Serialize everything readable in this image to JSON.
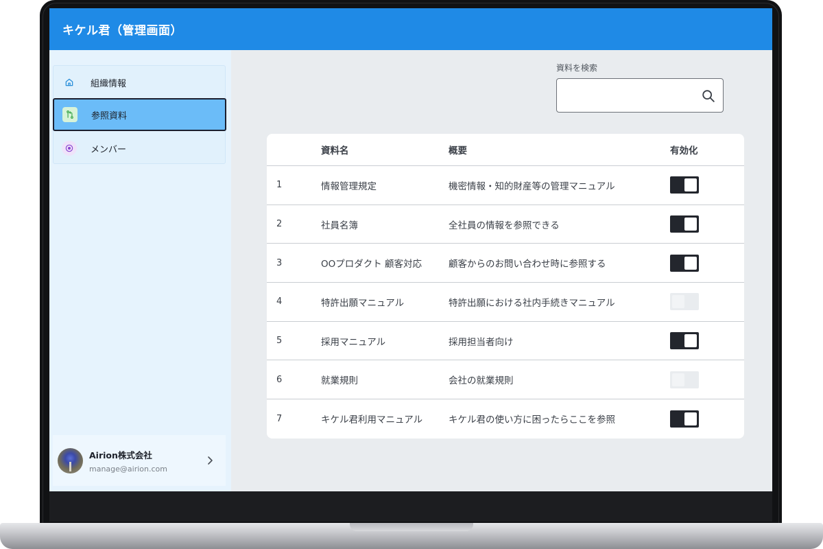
{
  "app": {
    "title": "キケル君（管理画面）"
  },
  "sidebar": {
    "items": [
      {
        "label": "組織情報",
        "icon": "home-icon",
        "active": false
      },
      {
        "label": "参照資料",
        "icon": "git-branch-icon",
        "active": true
      },
      {
        "label": "メンバー",
        "icon": "member-icon",
        "active": false
      }
    ],
    "user": {
      "name": "Airion株式会社",
      "email": "manage@airion.com"
    }
  },
  "search": {
    "label": "資料を検索",
    "value": "",
    "placeholder": ""
  },
  "table": {
    "headers": {
      "no": "",
      "name": "資料名",
      "description": "概要",
      "enabled": "有効化"
    },
    "rows": [
      {
        "no": "1",
        "name": "情報管理規定",
        "description": "機密情報・知的財産等の管理マニュアル",
        "enabled": true
      },
      {
        "no": "2",
        "name": "社員名簿",
        "description": "全社員の情報を参照できる",
        "enabled": true
      },
      {
        "no": "3",
        "name": "OOプロダクト 顧客対応",
        "description": "顧客からのお問い合わせ時に参照する",
        "enabled": true
      },
      {
        "no": "4",
        "name": "特許出願マニュアル",
        "description": "特許出願における社内手続きマニュアル",
        "enabled": false
      },
      {
        "no": "5",
        "name": "採用マニュアル",
        "description": "採用担当者向け",
        "enabled": true
      },
      {
        "no": "6",
        "name": "就業規則",
        "description": "会社の就業規則",
        "enabled": false
      },
      {
        "no": "7",
        "name": "キケル君利用マニュアル",
        "description": "キケル君の使い方に困ったらここを参照",
        "enabled": true
      }
    ]
  },
  "colors": {
    "header": "#1f8ae6",
    "sidebar": "#e6f3fd",
    "active_item": "#6bbcf8",
    "toggle_on": "#23262d",
    "toggle_off": "#e9ecef"
  }
}
